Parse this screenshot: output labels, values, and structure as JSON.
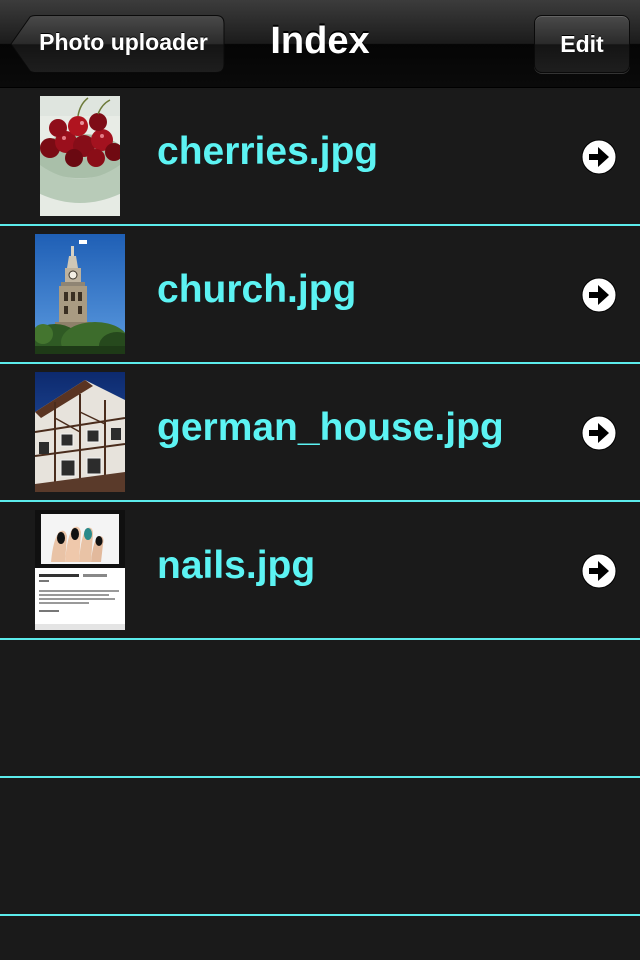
{
  "navbar": {
    "title": "Index",
    "back_label": "Photo uploader",
    "edit_label": "Edit"
  },
  "rows": [
    {
      "label": "cherries.jpg",
      "thumbnail": "cherries-photo"
    },
    {
      "label": "church.jpg",
      "thumbnail": "church-tower-photo"
    },
    {
      "label": "german_house.jpg",
      "thumbnail": "half-timbered-house-photo"
    },
    {
      "label": "nails.jpg",
      "thumbnail": "nails-screenshot"
    },
    {
      "label": ""
    },
    {
      "label": ""
    }
  ],
  "colors": {
    "background": "#1a1a1a",
    "label_text": "#5cf3f3",
    "separator": "#5cecec"
  },
  "icons": {
    "disclosure": "detail-disclosure-arrow-icon"
  }
}
